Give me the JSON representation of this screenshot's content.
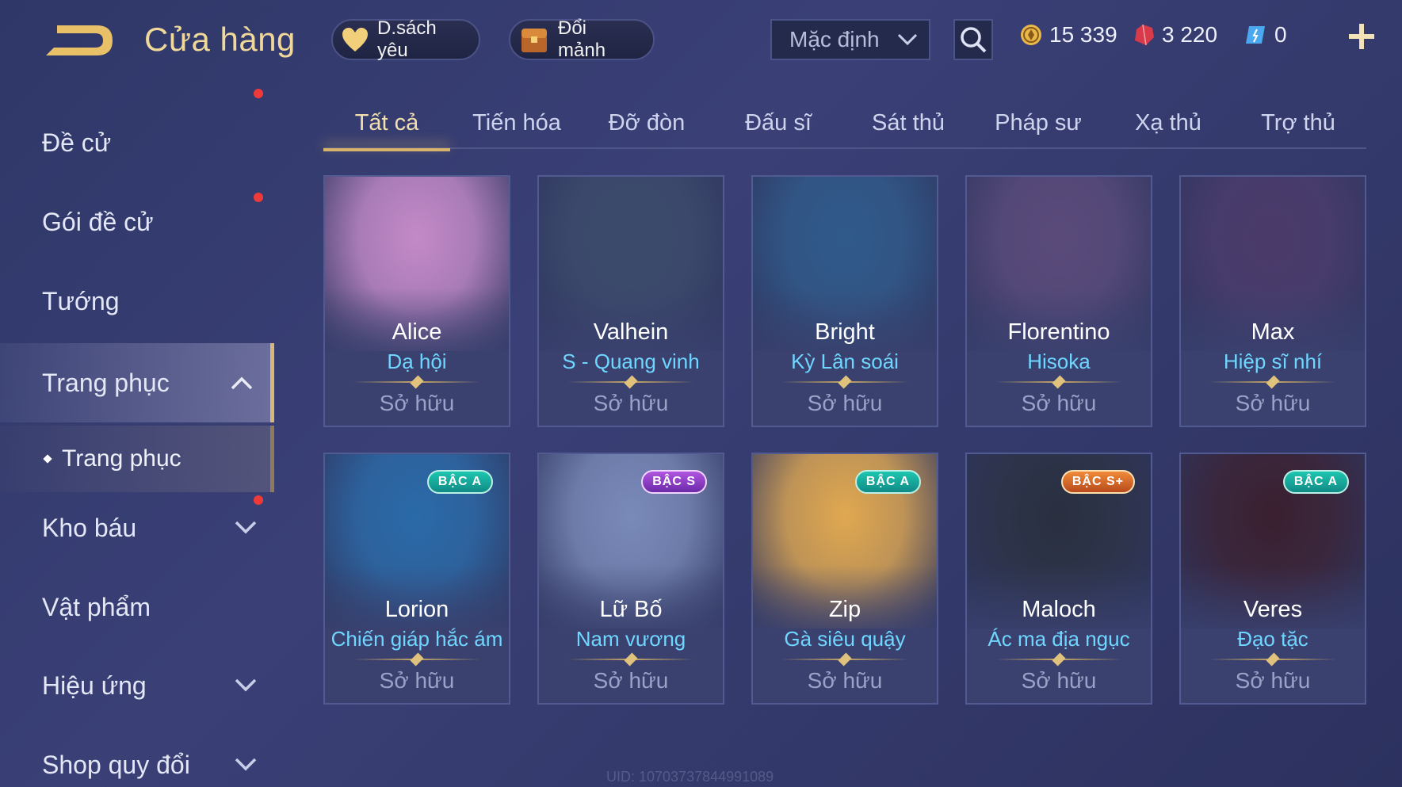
{
  "header": {
    "title": "Cửa hàng",
    "favorites_label": "D.sách yêu",
    "shards_label": "Đổi mảnh",
    "sort_value": "Mặc định",
    "currency": {
      "gold": "15 339",
      "ruby": "3 220",
      "voucher": "0"
    }
  },
  "sidebar": {
    "items": [
      {
        "label": "Đề cử"
      },
      {
        "label": "Gói đề cử"
      },
      {
        "label": "Tướng"
      },
      {
        "label": "Trang phục"
      },
      {
        "label": "Trang phục"
      },
      {
        "label": "Kho báu"
      },
      {
        "label": "Vật phẩm"
      },
      {
        "label": "Hiệu ứng"
      },
      {
        "label": "Shop quy đổi"
      }
    ]
  },
  "tabs": [
    {
      "label": "Tất cả"
    },
    {
      "label": "Tiến hóa"
    },
    {
      "label": "Đỡ đòn"
    },
    {
      "label": "Đấu sĩ"
    },
    {
      "label": "Sát thủ"
    },
    {
      "label": "Pháp sư"
    },
    {
      "label": "Xạ thủ"
    },
    {
      "label": "Trợ thủ"
    }
  ],
  "cards": [
    {
      "hero": "Alice",
      "skin": "Dạ hội",
      "status": "Sở hữu",
      "badge": "",
      "color": "#c48ac8"
    },
    {
      "hero": "Valhein",
      "skin": "S - Quang vinh",
      "status": "Sở hữu",
      "badge": "",
      "color": "#3b4a6a"
    },
    {
      "hero": "Bright",
      "skin": "Kỳ Lân soái",
      "status": "Sở hữu",
      "badge": "",
      "color": "#2f5a8a"
    },
    {
      "hero": "Florentino",
      "skin": "Hisoka",
      "status": "Sở hữu",
      "badge": "",
      "color": "#5a4a7a"
    },
    {
      "hero": "Max",
      "skin": "Hiệp sĩ nhí",
      "status": "Sở hữu",
      "badge": "",
      "color": "#4a3a6a"
    },
    {
      "hero": "Lorion",
      "skin": "Chiến giáp hắc ám",
      "status": "Sở hữu",
      "badge": "BẬC A",
      "color": "#2a6aa8"
    },
    {
      "hero": "Lữ Bố",
      "skin": "Nam vương",
      "status": "Sở hữu",
      "badge": "BẬC S",
      "color": "#7a8ab8"
    },
    {
      "hero": "Zip",
      "skin": "Gà siêu quậy",
      "status": "Sở hữu",
      "badge": "BẬC A",
      "color": "#e0a850"
    },
    {
      "hero": "Maloch",
      "skin": "Ác ma địa ngục",
      "status": "Sở hữu",
      "badge": "BẬC S+",
      "color": "#2a3040"
    },
    {
      "hero": "Veres",
      "skin": "Đạo tặc",
      "status": "Sở hữu",
      "badge": "BẬC A",
      "color": "#3a2030"
    }
  ],
  "uid": "UID: 10703737844991089"
}
